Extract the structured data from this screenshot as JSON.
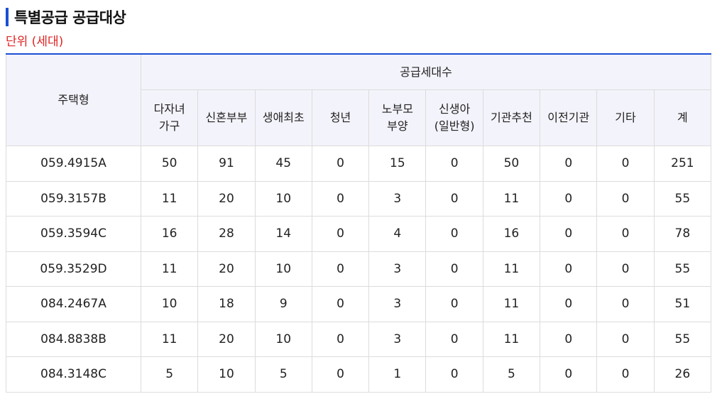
{
  "page": {
    "title": "특별공급 공급대상",
    "unit_note": "단위 (세대)"
  },
  "colors": {
    "accent": "#1a4fd6",
    "unit_text": "#e02424",
    "header_bg": "#f3f3fb"
  },
  "table": {
    "row_header": "주택형",
    "group_header": "공급세대수",
    "columns": [
      {
        "line1": "다자녀",
        "line2": "가구"
      },
      {
        "line1": "신혼부부",
        "line2": ""
      },
      {
        "line1": "생애최초",
        "line2": ""
      },
      {
        "line1": "청년",
        "line2": ""
      },
      {
        "line1": "노부모",
        "line2": "부양"
      },
      {
        "line1": "신생아",
        "line2": "(일반형)"
      },
      {
        "line1": "기관추천",
        "line2": ""
      },
      {
        "line1": "이전기관",
        "line2": ""
      },
      {
        "line1": "기타",
        "line2": ""
      },
      {
        "line1": "계",
        "line2": ""
      }
    ],
    "rows": [
      {
        "type": "059.4915A",
        "values": [
          "50",
          "91",
          "45",
          "0",
          "15",
          "0",
          "50",
          "0",
          "0",
          "251"
        ]
      },
      {
        "type": "059.3157B",
        "values": [
          "11",
          "20",
          "10",
          "0",
          "3",
          "0",
          "11",
          "0",
          "0",
          "55"
        ]
      },
      {
        "type": "059.3594C",
        "values": [
          "16",
          "28",
          "14",
          "0",
          "4",
          "0",
          "16",
          "0",
          "0",
          "78"
        ]
      },
      {
        "type": "059.3529D",
        "values": [
          "11",
          "20",
          "10",
          "0",
          "3",
          "0",
          "11",
          "0",
          "0",
          "55"
        ]
      },
      {
        "type": "084.2467A",
        "values": [
          "10",
          "18",
          "9",
          "0",
          "3",
          "0",
          "11",
          "0",
          "0",
          "51"
        ]
      },
      {
        "type": "084.8838B",
        "values": [
          "11",
          "20",
          "10",
          "0",
          "3",
          "0",
          "11",
          "0",
          "0",
          "55"
        ]
      },
      {
        "type": "084.3148C",
        "values": [
          "5",
          "10",
          "5",
          "0",
          "1",
          "0",
          "5",
          "0",
          "0",
          "26"
        ]
      }
    ]
  }
}
